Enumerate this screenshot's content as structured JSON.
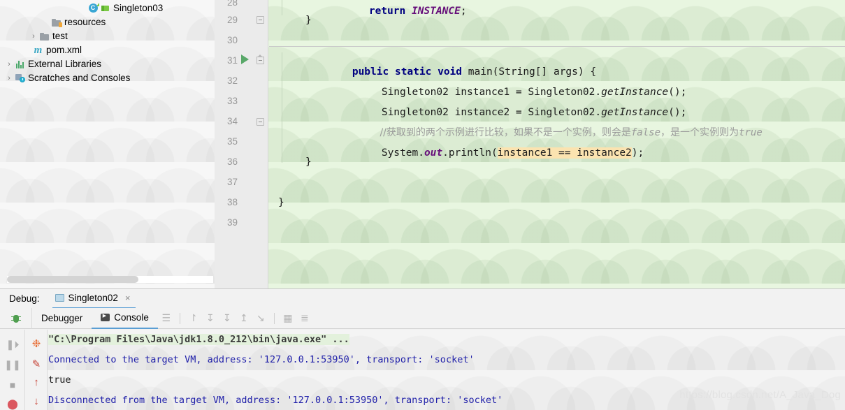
{
  "project": {
    "items": [
      {
        "indent": 5,
        "arrow": "",
        "icon": "module-icon",
        "label": "Singleton03"
      },
      {
        "indent": 4,
        "arrow": "",
        "icon": "folder-resources-icon",
        "label": "resources"
      },
      {
        "indent": 3,
        "arrow": "›",
        "icon": "folder-icon",
        "label": "test"
      },
      {
        "indent": 3,
        "arrow": "",
        "icon": "maven-pom-icon",
        "label": "pom.xml"
      },
      {
        "indent": 1,
        "arrow": "›",
        "icon": "libraries-icon",
        "label": "External Libraries"
      },
      {
        "indent": 1,
        "arrow": "›",
        "icon": "scratches-icon",
        "label": "Scratches and Consoles"
      }
    ]
  },
  "editor": {
    "line_numbers": [
      "28",
      "29",
      "30",
      "31",
      "32",
      "33",
      "34",
      "35",
      "36",
      "37",
      "38",
      "39"
    ],
    "code": {
      "l28_kw": "return",
      "l28_field": "INSTANCE",
      "l28_semi": ";",
      "l29": "}",
      "l31_kw1": "public",
      "l31_kw2": "static",
      "l31_kw3": "void",
      "l31_rest": "main(String[] args) {",
      "l32_a": "Singleton02 instance1 = Singleton02.",
      "l32_m": "getInstance",
      "l32_b": "();",
      "l33_a": "Singleton02 instance2 = Singleton02.",
      "l33_m": "getInstance",
      "l33_b": "();",
      "l34_c1": "//获取到的两个示例进行比较，如果不是一个实例，则会是",
      "l34_c2": "false",
      "l34_c3": "，是一个实例则为",
      "l34_c4": "true",
      "l35_a": "System.",
      "l35_out": "out",
      "l35_b": ".println(",
      "l35_hl": "instance1 == instance2",
      "l35_c": ");",
      "l36": "}",
      "l38": "}"
    }
  },
  "debug": {
    "label": "Debug:",
    "tab_name": "Singleton02",
    "close": "×",
    "tabs": [
      {
        "label": "Debugger",
        "icon": "debugger-icon"
      },
      {
        "label": "Console",
        "icon": "console-icon"
      }
    ],
    "toolbar_icons": [
      "layout-icon",
      "step-over-icon",
      "step-into-icon",
      "force-step-into-icon",
      "step-out-icon",
      "run-to-cursor-icon",
      "evaluate-icon",
      "settings-icon"
    ],
    "run_controls": [
      "resume-icon",
      "pause-icon",
      "stop-icon",
      "breakpoints-icon"
    ],
    "console_controls": [
      "rerun-icon",
      "soft-wrap-icon",
      "scroll-up-icon",
      "scroll-down-icon",
      "print-icon"
    ]
  },
  "console": {
    "lines": [
      {
        "type": "cmd",
        "text": "\"C:\\Program Files\\Java\\jdk1.8.0_212\\bin\\java.exe\" ..."
      },
      {
        "type": "sys",
        "text": "Connected to the target VM, address: '127.0.0.1:53950', transport: 'socket'"
      },
      {
        "type": "out",
        "text": "true"
      },
      {
        "type": "sys",
        "text": "Disconnected from the target VM, address: '127.0.0.1:53950', transport: 'socket'"
      }
    ]
  },
  "watermark": {
    "text": "https://blog.csdn.net/A_Java_Dog"
  }
}
